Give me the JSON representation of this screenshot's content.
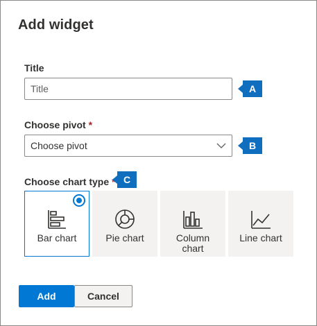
{
  "dialog": {
    "title": "Add widget"
  },
  "title_field": {
    "label": "Title",
    "placeholder": "Title",
    "value": "",
    "callout": "A"
  },
  "pivot_field": {
    "label": "Choose pivot",
    "required_mark": "*",
    "selected": "Choose pivot",
    "callout": "B"
  },
  "chart_type": {
    "label": "Choose chart type",
    "required_mark": "*",
    "callout": "C",
    "selected": "Bar chart",
    "options": [
      {
        "label": "Bar chart",
        "icon": "bar-chart-icon"
      },
      {
        "label": "Pie chart",
        "icon": "pie-chart-icon"
      },
      {
        "label": "Column chart",
        "icon": "column-chart-icon"
      },
      {
        "label": "Line chart",
        "icon": "line-chart-icon"
      }
    ]
  },
  "buttons": {
    "add_label": "Add",
    "cancel_label": "Cancel"
  },
  "colors": {
    "accent": "#0078d4",
    "callout": "#106ebe",
    "required": "#a4262c"
  }
}
